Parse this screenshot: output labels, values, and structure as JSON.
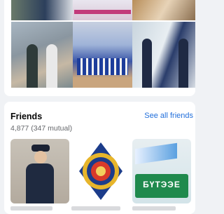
{
  "photos": {
    "items": [
      {
        "name": "photo-1"
      },
      {
        "name": "photo-2"
      },
      {
        "name": "photo-3"
      },
      {
        "name": "photo-4"
      },
      {
        "name": "photo-5"
      },
      {
        "name": "photo-6"
      }
    ]
  },
  "friends": {
    "title": "Friends",
    "count": "4,877 (347 mutual)",
    "see_all": "See all friends",
    "thumbnails": [
      {
        "name": "friend-officer"
      },
      {
        "name": "friend-seal-emblem"
      },
      {
        "name": "friend-buteel-banner",
        "banner_text": "БҮТЭЭЕ"
      }
    ]
  }
}
